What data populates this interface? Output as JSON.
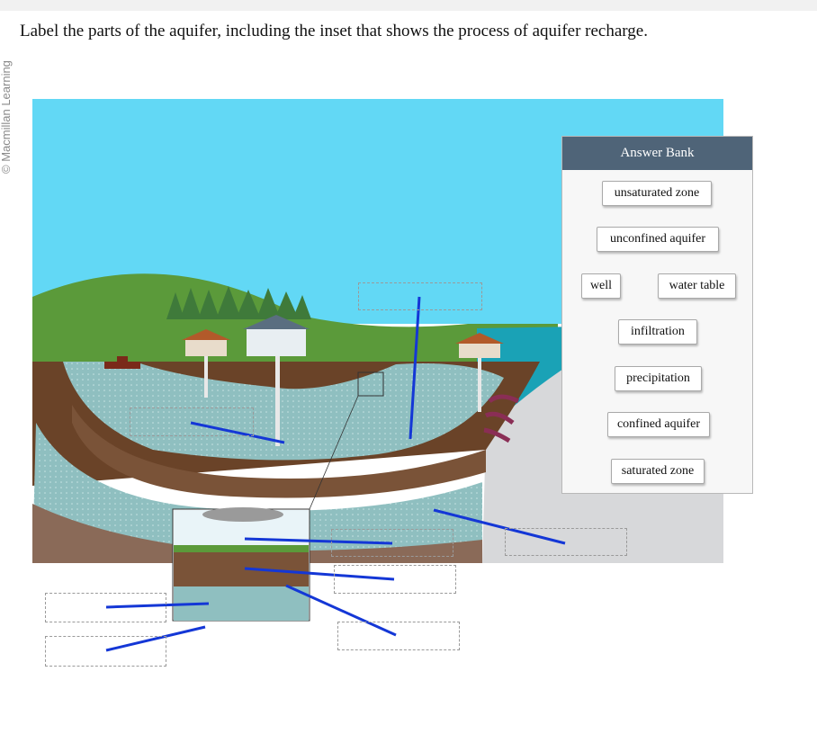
{
  "header": {
    "copyright": "© Macmillan Learning",
    "question": "Label the parts of the aquifer, including the inset that shows the process of aquifer recharge."
  },
  "answer_bank": {
    "title": "Answer Bank",
    "labels": [
      "unsaturated zone",
      "unconfined aquifer",
      "well",
      "water table",
      "infiltration",
      "precipitation",
      "confined aquifer",
      "saturated zone"
    ]
  },
  "colors": {
    "sky": "#62d8f5",
    "grass": "#5b9a3a",
    "aquifer_water": "#8fbfc0",
    "confining_layer": "#7a5338",
    "bank_header": "#4f6478",
    "leader_line": "#1437d6"
  }
}
